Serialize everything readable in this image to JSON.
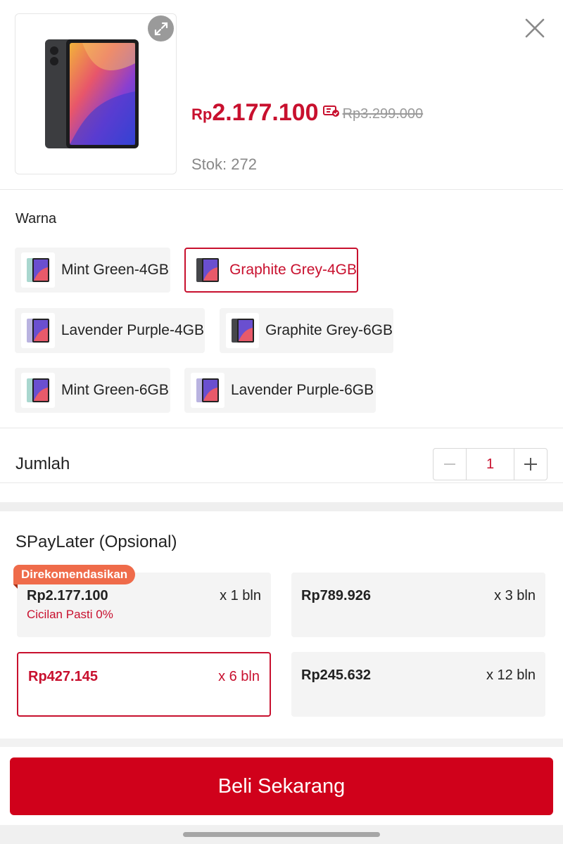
{
  "product": {
    "price_currency": "Rp",
    "price": "2.177.100",
    "original_price": "Rp3.299.000",
    "stock": "Stok: 272"
  },
  "icons": {
    "expand": "expand-icon",
    "close": "close-icon",
    "voucher": "voucher-icon",
    "minus": "minus-icon",
    "plus": "plus-icon"
  },
  "variations": {
    "title": "Warna",
    "options": [
      {
        "label": "Mint Green-4GB",
        "selected": false
      },
      {
        "label": "Graphite Grey-4GB",
        "selected": true
      },
      {
        "label": "Lavender Purple-4GB",
        "selected": false
      },
      {
        "label": "Graphite Grey-6GB",
        "selected": false
      },
      {
        "label": "Mint Green-6GB",
        "selected": false
      },
      {
        "label": "Lavender Purple-6GB",
        "selected": false
      }
    ]
  },
  "quantity": {
    "label": "Jumlah",
    "value": "1"
  },
  "paylater": {
    "title": "SPayLater (Opsional)",
    "badge": "Direkomendasikan",
    "options": [
      {
        "amount": "Rp2.177.100",
        "duration": "x 1 bln",
        "note": "Cicilan Pasti 0%",
        "selected": false
      },
      {
        "amount": "Rp789.926",
        "duration": "x 3 bln",
        "note": "",
        "selected": false
      },
      {
        "amount": "Rp427.145",
        "duration": "x 6 bln",
        "note": "",
        "selected": true
      },
      {
        "amount": "Rp245.632",
        "duration": "x 12 bln",
        "note": "",
        "selected": false
      }
    ]
  },
  "footer": {
    "buy_label": "Beli Sekarang"
  },
  "colors": {
    "accent": "#c8102e",
    "button": "#d0011b",
    "badge": "#ef6b4a"
  }
}
